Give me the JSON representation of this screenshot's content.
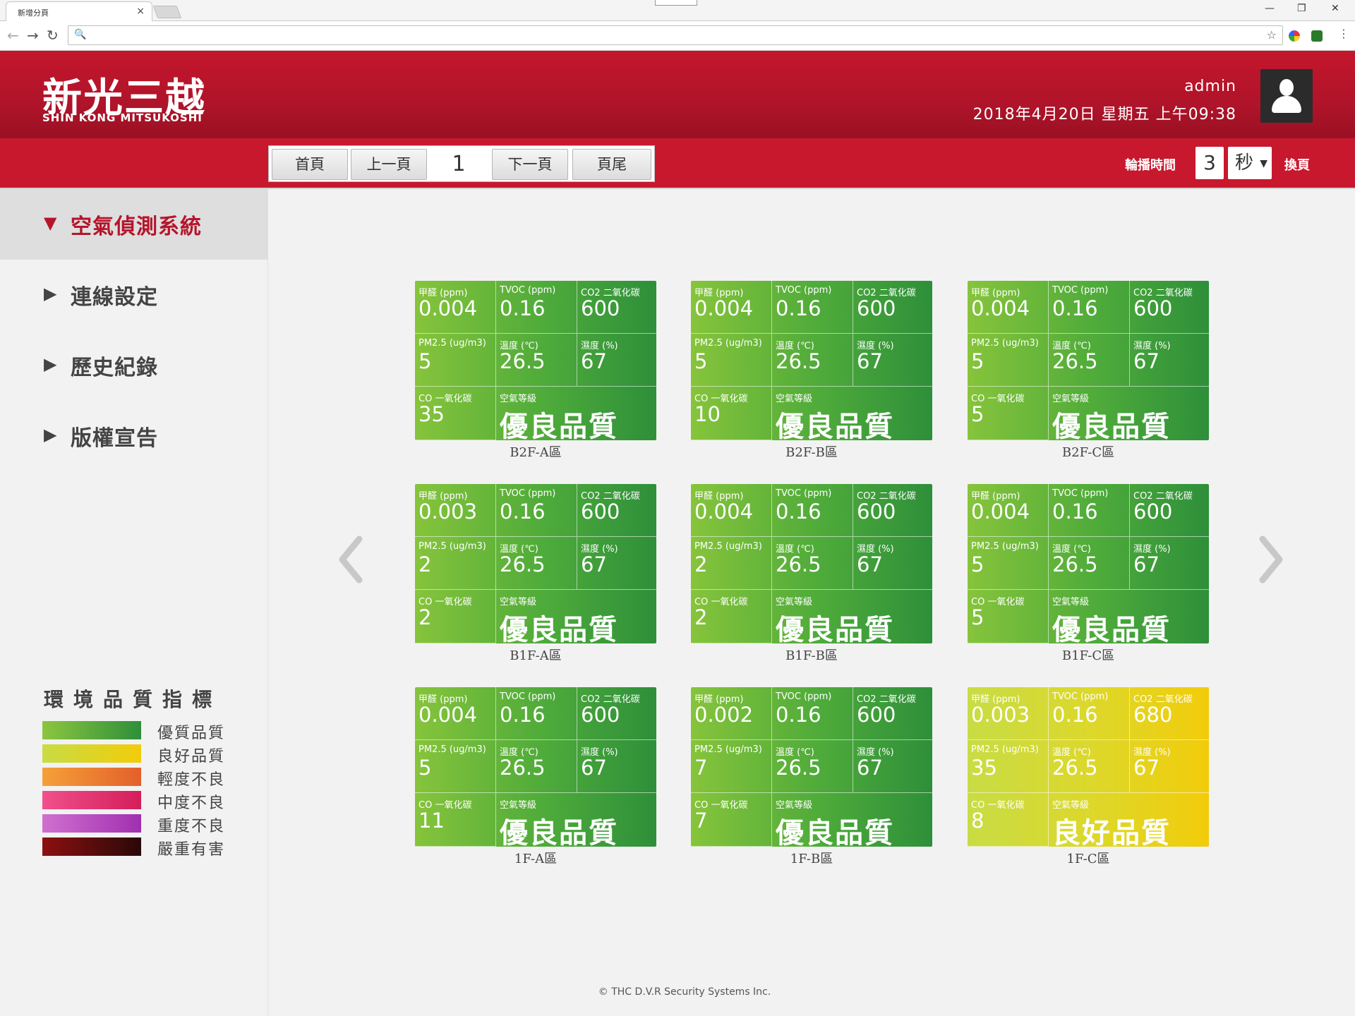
{
  "browser": {
    "tab_title": "新增分頁",
    "tab_close": "×",
    "back": "←",
    "forward": "→",
    "reload": "↻",
    "omni_icon": "🔍",
    "star": "☆",
    "menu": "⋮",
    "minimize": "—",
    "restore": "❐",
    "close": "✕",
    "omnibox_value": ""
  },
  "header": {
    "logo_cn": "新光三越",
    "logo_en": "SHIN KONG MITSUKOSHI",
    "user": "admin",
    "datetime": "2018年4月20日 星期五 上午09:38"
  },
  "pager": {
    "first": "首頁",
    "prev": "上一頁",
    "page": "1",
    "next": "下一頁",
    "last": "頁尾"
  },
  "rotation": {
    "label": "輪播時間",
    "value": "3",
    "unit": "秒",
    "swap": "換頁"
  },
  "sidebar": {
    "items": [
      {
        "arrow": "▼",
        "label": "空氣偵測系統"
      },
      {
        "arrow": "▶",
        "label": "連線設定"
      },
      {
        "arrow": "▶",
        "label": "歷史紀錄"
      },
      {
        "arrow": "▶",
        "label": "版權宣告"
      }
    ]
  },
  "legend": {
    "title": "環境品質指標",
    "items": [
      {
        "label": "優質品質",
        "from": "#8cc63f",
        "to": "#2e8f3a"
      },
      {
        "label": "良好品質",
        "from": "#c8dc44",
        "to": "#f2cc0a"
      },
      {
        "label": "輕度不良",
        "from": "#f5a03a",
        "to": "#e2602a"
      },
      {
        "label": "中度不良",
        "from": "#f0508a",
        "to": "#d41e5a"
      },
      {
        "label": "重度不良",
        "from": "#d070d0",
        "to": "#a030b0"
      },
      {
        "label": "嚴重有害",
        "from": "#8c1010",
        "to": "#2a0808"
      }
    ]
  },
  "labels": {
    "formaldehyde": "甲醛 (ppm)",
    "tvoc": "TVOC (ppm)",
    "co2": "CO2 二氧化碳",
    "pm25": "PM2.5 (ug/m3)",
    "temp": "溫度 (℃)",
    "humidity": "濕度 (%)",
    "co": "CO 一氧化碳",
    "aqi": "空氣等級"
  },
  "cards": [
    {
      "zone": "B2F-A區",
      "hcho": "0.004",
      "tvoc": "0.16",
      "co2": "600",
      "pm25": "5",
      "temp": "26.5",
      "hum": "67",
      "co": "35",
      "grade": "優良品質",
      "status": "good"
    },
    {
      "zone": "B2F-B區",
      "hcho": "0.004",
      "tvoc": "0.16",
      "co2": "600",
      "pm25": "5",
      "temp": "26.5",
      "hum": "67",
      "co": "10",
      "grade": "優良品質",
      "status": "good"
    },
    {
      "zone": "B2F-C區",
      "hcho": "0.004",
      "tvoc": "0.16",
      "co2": "600",
      "pm25": "5",
      "temp": "26.5",
      "hum": "67",
      "co": "5",
      "grade": "優良品質",
      "status": "good"
    },
    {
      "zone": "B1F-A區",
      "hcho": "0.003",
      "tvoc": "0.16",
      "co2": "600",
      "pm25": "2",
      "temp": "26.5",
      "hum": "67",
      "co": "2",
      "grade": "優良品質",
      "status": "good"
    },
    {
      "zone": "B1F-B區",
      "hcho": "0.004",
      "tvoc": "0.16",
      "co2": "600",
      "pm25": "2",
      "temp": "26.5",
      "hum": "67",
      "co": "2",
      "grade": "優良品質",
      "status": "good"
    },
    {
      "zone": "B1F-C區",
      "hcho": "0.004",
      "tvoc": "0.16",
      "co2": "600",
      "pm25": "5",
      "temp": "26.5",
      "hum": "67",
      "co": "5",
      "grade": "優良品質",
      "status": "good"
    },
    {
      "zone": "1F-A區",
      "hcho": "0.004",
      "tvoc": "0.16",
      "co2": "600",
      "pm25": "5",
      "temp": "26.5",
      "hum": "67",
      "co": "11",
      "grade": "優良品質",
      "status": "good"
    },
    {
      "zone": "1F-B區",
      "hcho": "0.002",
      "tvoc": "0.16",
      "co2": "600",
      "pm25": "7",
      "temp": "26.5",
      "hum": "67",
      "co": "7",
      "grade": "優良品質",
      "status": "good"
    },
    {
      "zone": "1F-C區",
      "hcho": "0.003",
      "tvoc": "0.16",
      "co2": "680",
      "pm25": "35",
      "temp": "26.5",
      "hum": "67",
      "co": "8",
      "grade": "良好品質",
      "status": "fair"
    }
  ],
  "footer": "© THC D.V.R Security Systems Inc."
}
